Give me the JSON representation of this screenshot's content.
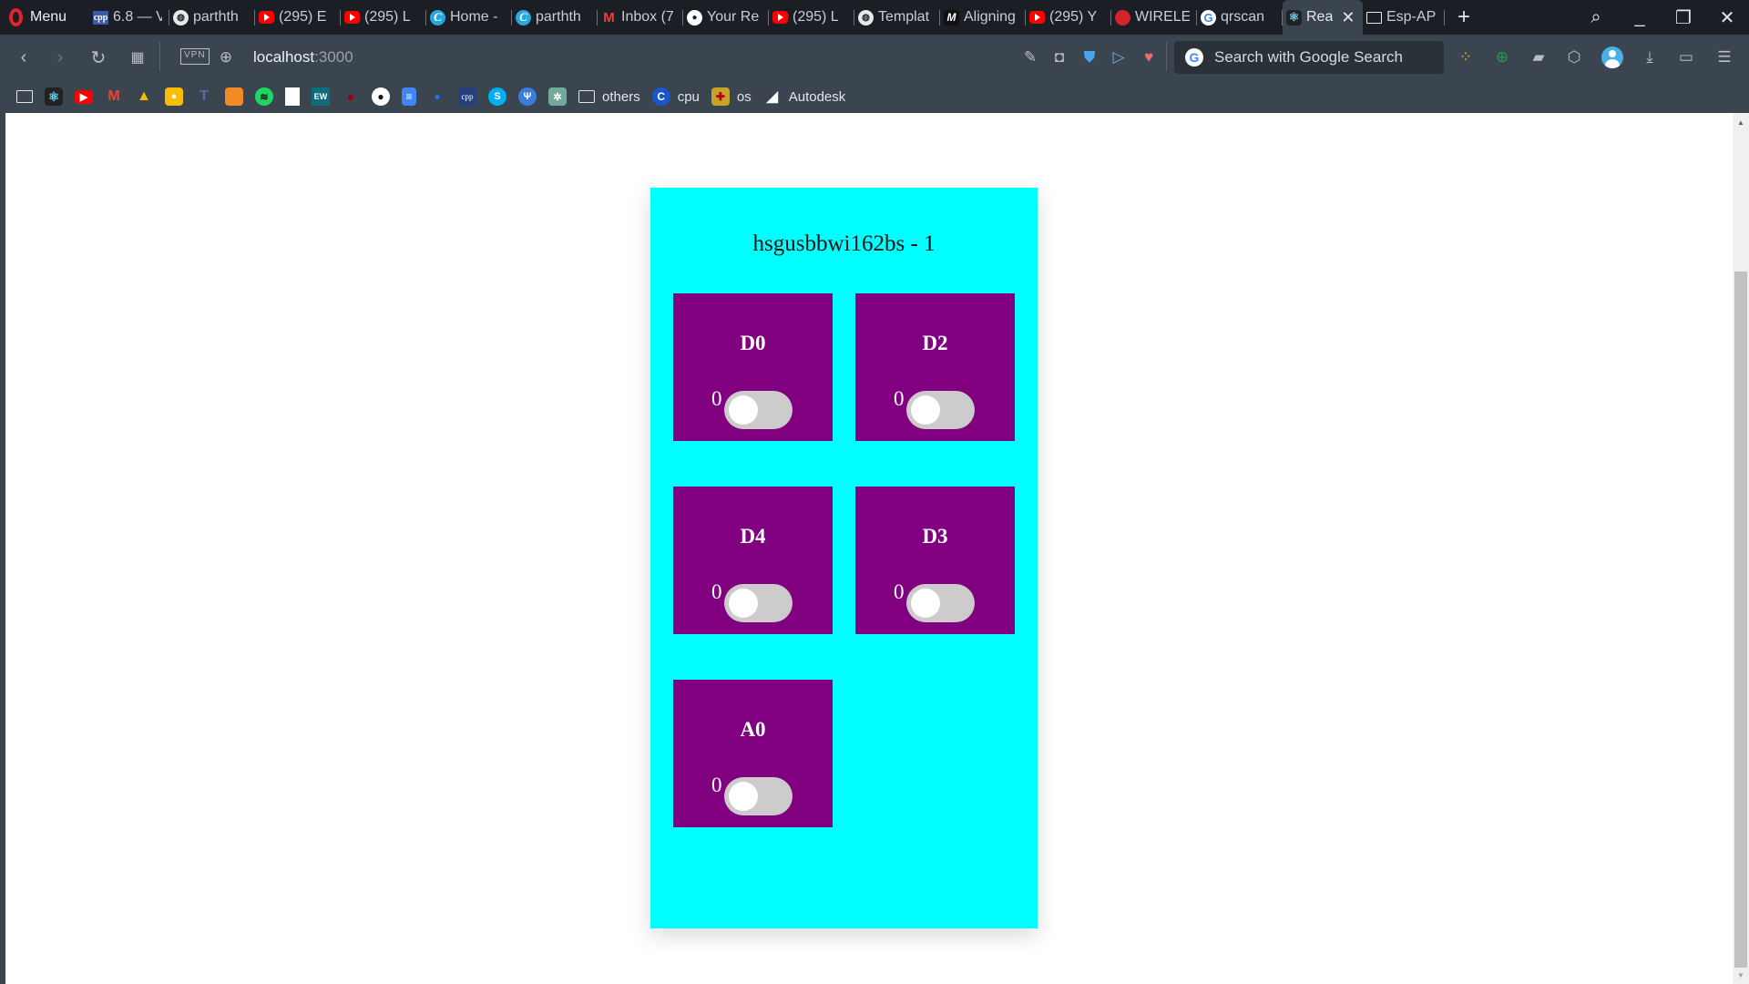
{
  "browser": {
    "menu_label": "Menu",
    "tabs": [
      {
        "icon": "cpp-icon",
        "title": "6.8 — V",
        "active": false
      },
      {
        "icon": "globe-icon",
        "title": "parthth",
        "active": false
      },
      {
        "icon": "youtube-icon",
        "title": "(295) E",
        "active": false
      },
      {
        "icon": "youtube-icon",
        "title": "(295) L",
        "active": false
      },
      {
        "icon": "canva-icon",
        "title": "Home -",
        "active": false
      },
      {
        "icon": "canva-icon",
        "title": "parthth",
        "active": false
      },
      {
        "icon": "gmail-icon",
        "title": "Inbox (7",
        "active": false
      },
      {
        "icon": "github-icon",
        "title": "Your Re",
        "active": false
      },
      {
        "icon": "youtube-icon",
        "title": "(295) L",
        "active": false
      },
      {
        "icon": "globe-icon",
        "title": "Templat",
        "active": false
      },
      {
        "icon": "m-icon",
        "title": "Aligning",
        "active": false
      },
      {
        "icon": "youtube-icon",
        "title": "(295) Y",
        "active": false
      },
      {
        "icon": "wireless-icon",
        "title": "WIRELE",
        "active": false
      },
      {
        "icon": "google-icon",
        "title": "qrscan",
        "active": false
      },
      {
        "icon": "react-icon",
        "title": "Rea",
        "active": true
      },
      {
        "icon": "reader-icon",
        "title": "Esp-AP",
        "active": false
      }
    ],
    "new_tab": "+",
    "address": {
      "host": "localhost",
      "port": ":3000",
      "vpn_label": "VPN"
    },
    "search": {
      "placeholder": "Search with Google Search"
    },
    "bookmarks": [
      {
        "icon": "reader-icon",
        "label": ""
      },
      {
        "icon": "react-icon",
        "label": ""
      },
      {
        "icon": "youtube-icon",
        "label": ""
      },
      {
        "icon": "gmail-icon",
        "label": ""
      },
      {
        "icon": "drive-icon",
        "label": ""
      },
      {
        "icon": "keep-icon",
        "label": ""
      },
      {
        "icon": "teams-icon",
        "label": ""
      },
      {
        "icon": "box-icon",
        "label": ""
      },
      {
        "icon": "spotify-icon",
        "label": ""
      },
      {
        "icon": "doc-icon",
        "label": ""
      },
      {
        "icon": "ew-icon",
        "label": ""
      },
      {
        "icon": "red-dots-icon",
        "label": ""
      },
      {
        "icon": "github-icon",
        "label": ""
      },
      {
        "icon": "google-docs-icon",
        "label": ""
      },
      {
        "icon": "blue-dot-icon",
        "label": ""
      },
      {
        "icon": "cpp-icon",
        "label": ""
      },
      {
        "icon": "skype-icon",
        "label": ""
      },
      {
        "icon": "telegram-icon",
        "label": ""
      },
      {
        "icon": "chatgpt-icon",
        "label": ""
      },
      {
        "icon": "folder-icon",
        "label": "others"
      },
      {
        "icon": "c-icon",
        "label": "cpu"
      },
      {
        "icon": "crest-icon",
        "label": "os"
      },
      {
        "icon": "autodesk-icon",
        "label": "Autodesk"
      }
    ]
  },
  "app": {
    "title": "hsgusbbwi162bs - 1",
    "colors": {
      "panel_bg": "#00ffff",
      "card_bg": "#800080",
      "switch_track": "#cccccc",
      "switch_knob": "#ffffff"
    },
    "pins": [
      {
        "label": "D0",
        "value": "0",
        "on": false
      },
      {
        "label": "D2",
        "value": "0",
        "on": false
      },
      {
        "label": "D4",
        "value": "0",
        "on": false
      },
      {
        "label": "D3",
        "value": "0",
        "on": false
      },
      {
        "label": "A0",
        "value": "0",
        "on": false
      }
    ]
  }
}
